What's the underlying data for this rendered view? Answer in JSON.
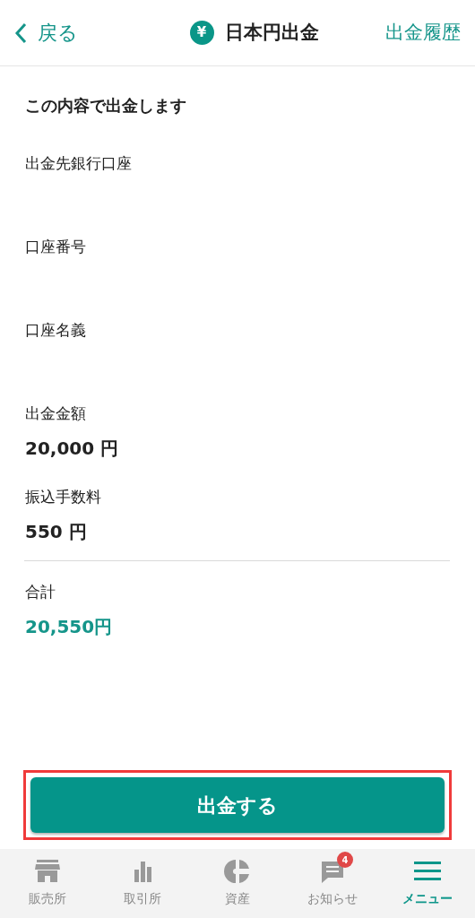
{
  "header": {
    "back": "戻る",
    "currency_symbol": "¥",
    "title": "日本円出金",
    "history_link": "出金履歴"
  },
  "heading": "この内容で出金します",
  "fields": [
    {
      "label": "出金先銀行口座"
    },
    {
      "label": "口座番号"
    },
    {
      "label": "口座名義"
    },
    {
      "label": "出金金額",
      "value": "20,000 円"
    },
    {
      "label": "振込手数料",
      "value": "550 円"
    }
  ],
  "total": {
    "label": "合計",
    "value": "20,550円"
  },
  "submit": {
    "label": "出金する",
    "highlighted": true
  },
  "bottom_nav": [
    {
      "kind": "store",
      "label": "販売所",
      "selected": false
    },
    {
      "kind": "bars",
      "label": "取引所",
      "selected": false
    },
    {
      "kind": "pie",
      "label": "資産",
      "selected": false
    },
    {
      "kind": "chat",
      "label": "お知らせ",
      "selected": false,
      "badge": "4"
    },
    {
      "kind": "menu",
      "label": "メニュー",
      "selected": true
    }
  ]
}
